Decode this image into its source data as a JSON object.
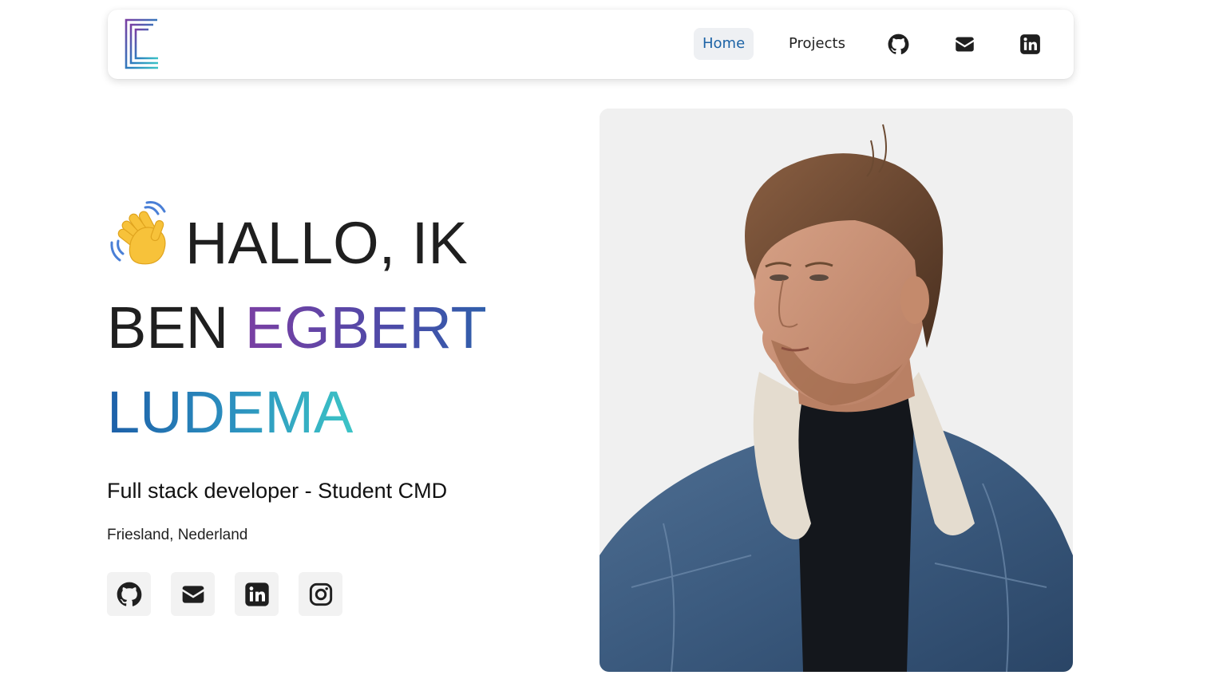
{
  "nav": {
    "logo": {
      "icon": "stacked-e-logo-icon",
      "gradient": [
        "#7a3fa3",
        "#2b8fbf",
        "#3cc4c6"
      ]
    },
    "links": [
      {
        "label": "Home",
        "active": true
      },
      {
        "label": "Projects",
        "active": false
      }
    ],
    "icons": [
      "github-icon",
      "mail-icon",
      "linkedin-icon"
    ]
  },
  "hero": {
    "emoji": "waving-hand-icon",
    "greeting": "HALLO, IK",
    "word_ben": "BEN",
    "name_first": "EGBERT",
    "name_last": "LUDEMA",
    "subtitle": "Full stack developer - Student CMD",
    "location": "Friesland, Nederland"
  },
  "socials": [
    "github-icon",
    "mail-icon",
    "linkedin-icon",
    "instagram-icon"
  ],
  "portrait": {
    "alt": "portrait-photo",
    "background": "#f0f0f0"
  },
  "colors": {
    "active_link": "#1c63a6",
    "egbert_gradient": [
      "#7a3fa3",
      "#2f5fab"
    ],
    "ludema_gradient": [
      "#1d5fa8",
      "#3cc4c6"
    ],
    "icon_color": "#1f1f1f"
  }
}
